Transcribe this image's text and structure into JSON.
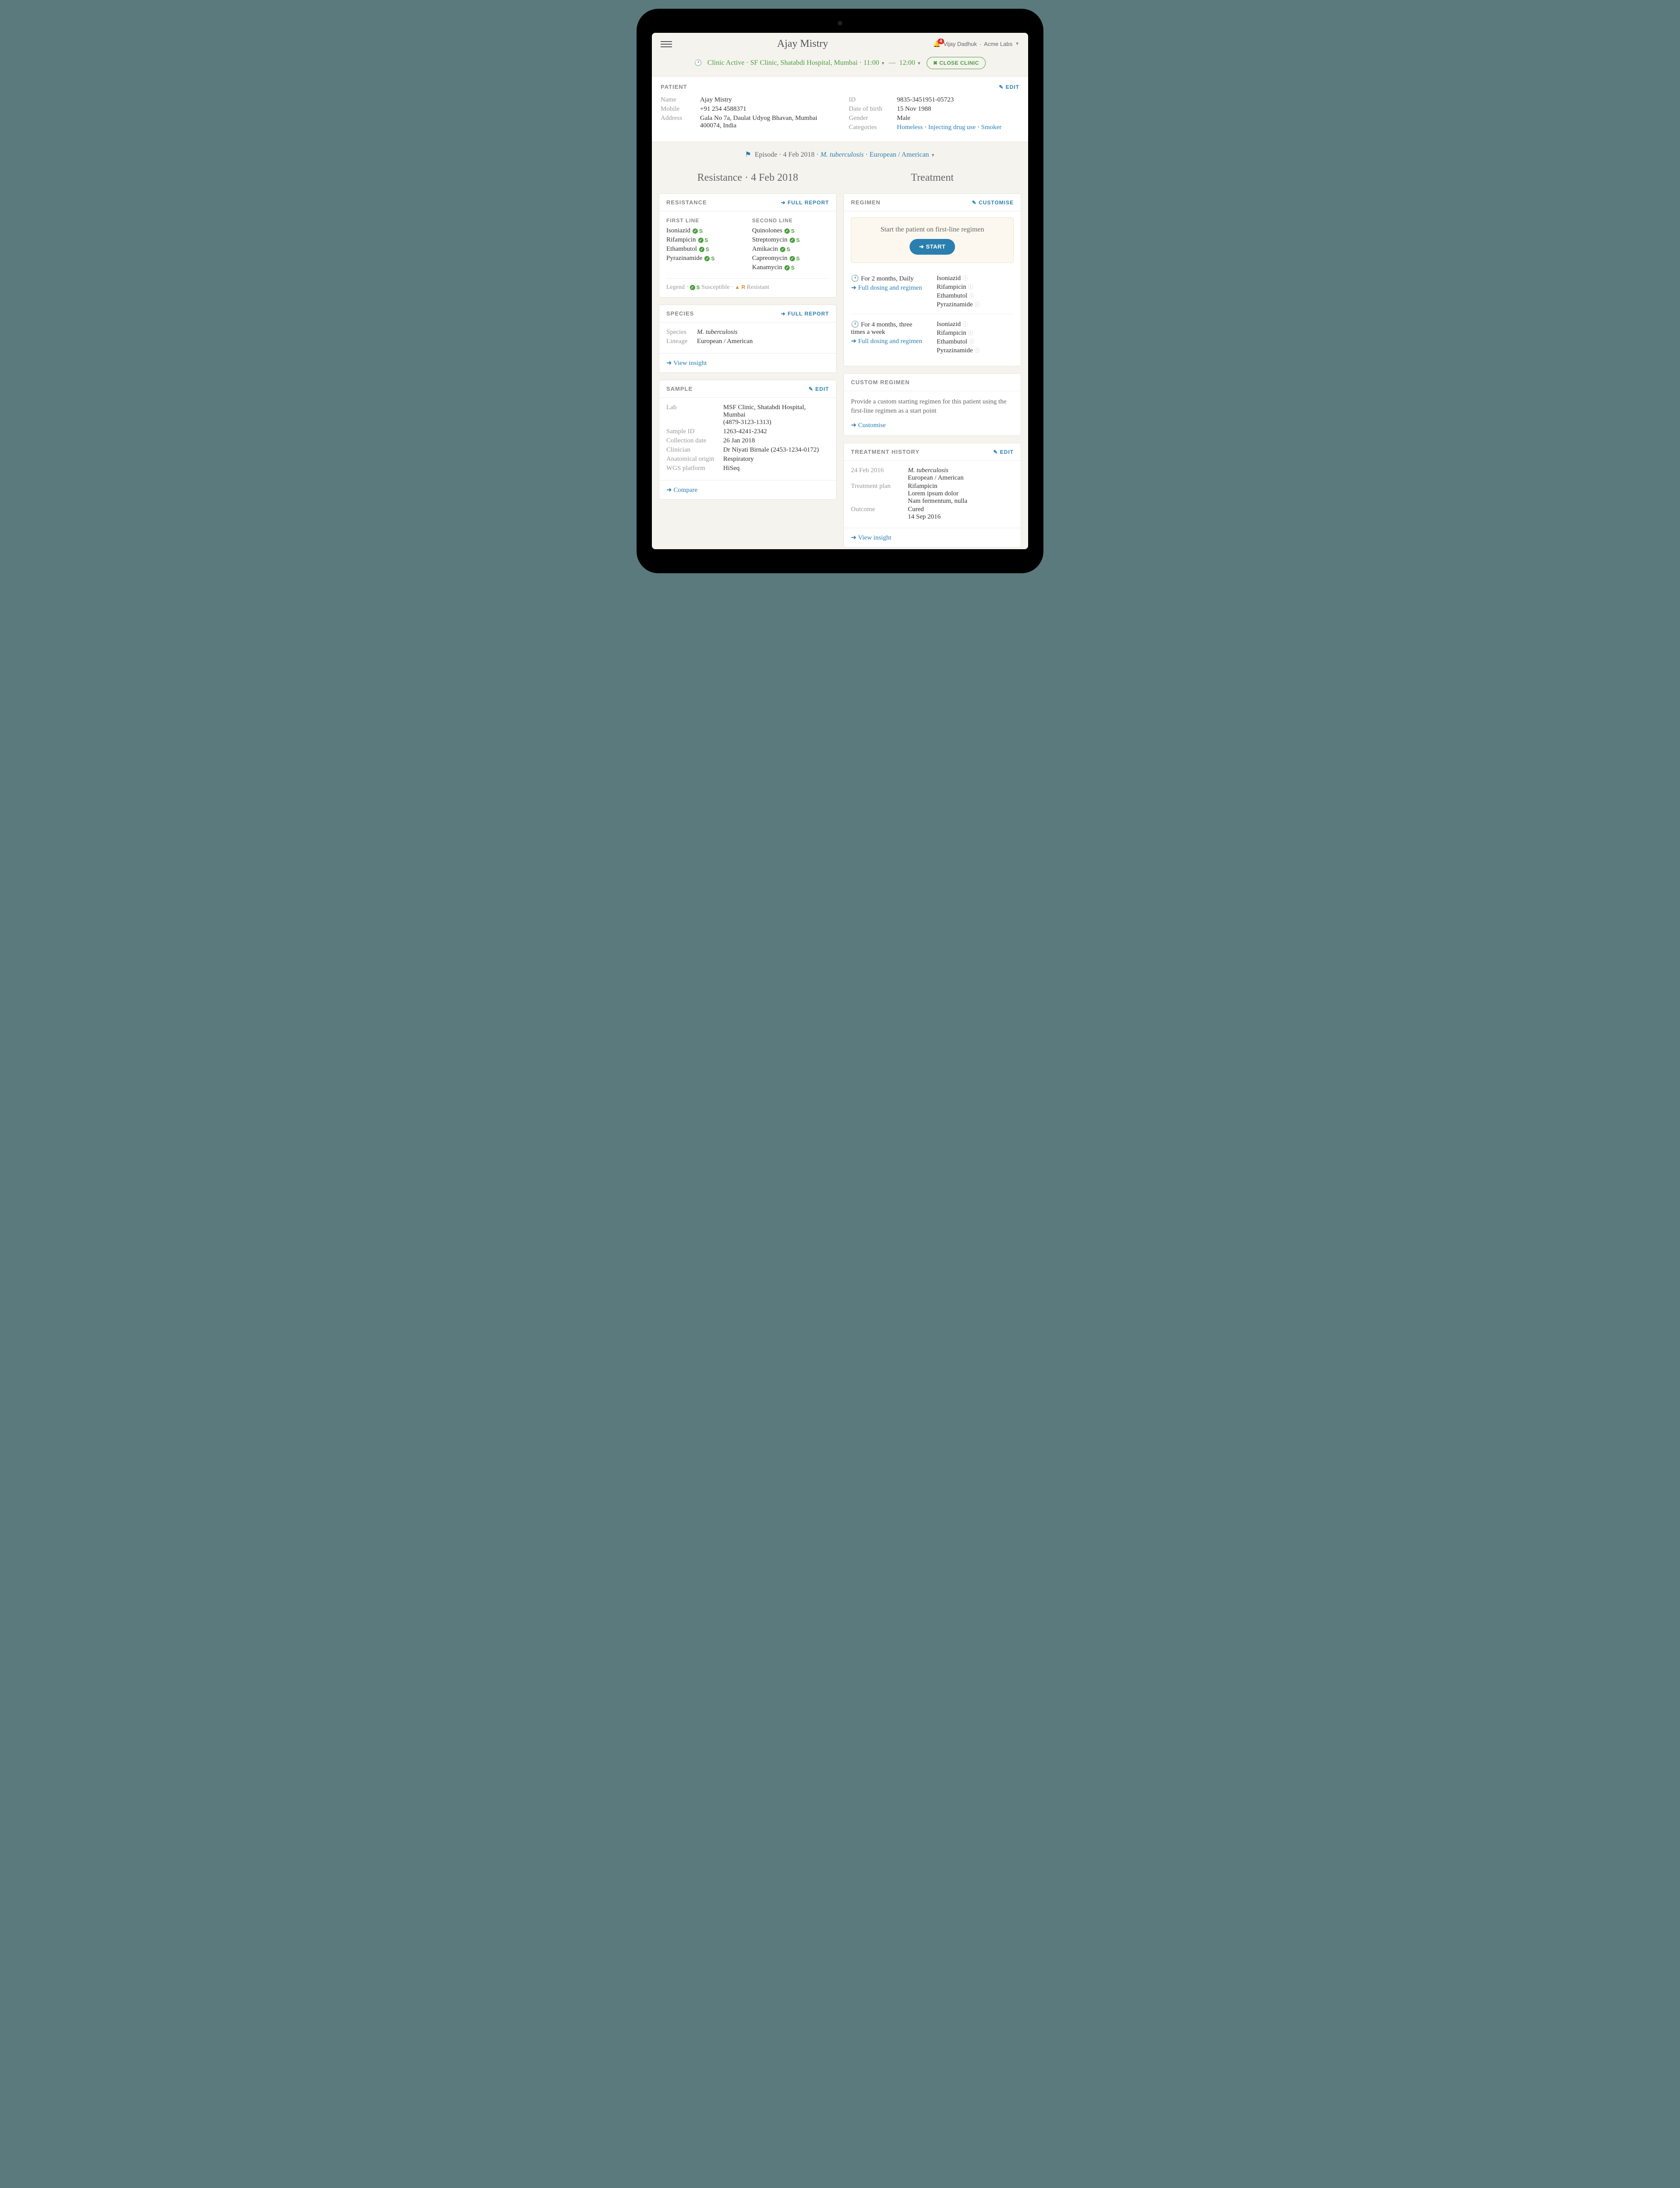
{
  "header": {
    "title": "Ajay Mistry",
    "notification_count": "4",
    "user_name": "Vijay Dadhuk",
    "org_name": "Acme Labs"
  },
  "clinic": {
    "status_label": "Clinic Active",
    "location": "SF Clinic, Shatabdi Hospital, Mumbai",
    "time_start": "11:00",
    "time_sep": "—",
    "time_end": "12:00",
    "close_label": "CLOSE CLINIC"
  },
  "patient": {
    "heading": "PATIENT",
    "edit_label": "EDIT",
    "labels": {
      "name": "Name",
      "mobile": "Mobile",
      "address": "Address",
      "id": "ID",
      "dob": "Date of birth",
      "gender": "Gender",
      "categories": "Categories"
    },
    "name": "Ajay Mistry",
    "mobile": "+91 254 4588371",
    "address_line1": "Gala No 7a, Daulat Udyog Bhavan, Mumbai",
    "address_line2": "400074, India",
    "id": "9835-3451951-05723",
    "dob": "15 Nov 1988",
    "gender": "Male",
    "categories": [
      "Homeless",
      "Injecting drug use",
      "Smoker"
    ]
  },
  "episode": {
    "label": "Episode",
    "date": "4 Feb 2018",
    "species": "M. tuberculosis",
    "lineage": "European / American"
  },
  "resistance": {
    "col_title": "Resistance · 4 Feb 2018",
    "heading": "RESISTANCE",
    "full_report": "FULL REPORT",
    "first_line_heading": "FIRST LINE",
    "second_line_heading": "SECOND LINE",
    "first_line": [
      "Isoniazid",
      "Rifampicin",
      "Ethambutol",
      "Pyrazinamide"
    ],
    "second_line": [
      "Quinolones",
      "Streptomycin",
      "Amikacin",
      "Capreomycin",
      "Kanamycin"
    ],
    "legend_label": "Legend",
    "susceptible_label": "Susceptible",
    "resistant_label": "Resistant"
  },
  "species": {
    "heading": "SPECIES",
    "full_report": "FULL REPORT",
    "labels": {
      "species": "Species",
      "lineage": "Lineage"
    },
    "species": "M. tuberculosis",
    "lineage": "European / American",
    "view_insight": "View insight"
  },
  "sample": {
    "heading": "SAMPLE",
    "edit_label": "EDIT",
    "labels": {
      "lab": "Lab",
      "sample_id": "Sample ID",
      "collection": "Collection date",
      "clinician": "Clinician",
      "origin": "Anatomical origin",
      "platform": "WGS platform"
    },
    "lab_line1": "MSF Clinic, Shatabdi Hospital, Mumbai",
    "lab_line2": "(4879-3123-1313)",
    "sample_id": "1263-4241-2342",
    "collection": "26 Jan 2018",
    "clinician": "Dr Niyati Birnale (2453-1234-0172)",
    "origin": "Respiratory",
    "platform": "HiSeq",
    "compare": "Compare"
  },
  "treatment": {
    "col_title": "Treatment",
    "regimen_heading": "REGIMEN",
    "customise_label": "CUSTOMISE",
    "start_text": "Start the patient on first-line regimen",
    "start_btn": "START",
    "blocks": [
      {
        "schedule": "For 2 months, Daily",
        "link": "Full dosing and regimen",
        "drugs": [
          "Isoniazid",
          "Rifampicin",
          "Ethambutol",
          "Pyrazinamide"
        ]
      },
      {
        "schedule": "For 4 months, three times a week",
        "link": "Full dosing and regimen",
        "drugs": [
          "Isoniazid",
          "Rifampicin",
          "Ethambutol",
          "Pyrazinamide"
        ]
      }
    ]
  },
  "custom": {
    "heading": "CUSTOM REGIMEN",
    "text": "Provide a custom starting regimen for this patient using the first-line regimen as a start point",
    "link": "Customise"
  },
  "history": {
    "heading": "TREATMENT HISTORY",
    "edit_label": "EDIT",
    "labels": {
      "date": "24 Feb 2016",
      "plan": "Treatment plan",
      "outcome": "Outcome"
    },
    "species": "M. tuberculosis",
    "lineage": "European / American",
    "plan_lines": [
      "Rifampicin",
      "Lorem ipsum dolor",
      "Nam fermentum, nulla"
    ],
    "outcome": "Cured",
    "outcome_date": "14 Sep 2016",
    "view_insight": "View insight"
  }
}
